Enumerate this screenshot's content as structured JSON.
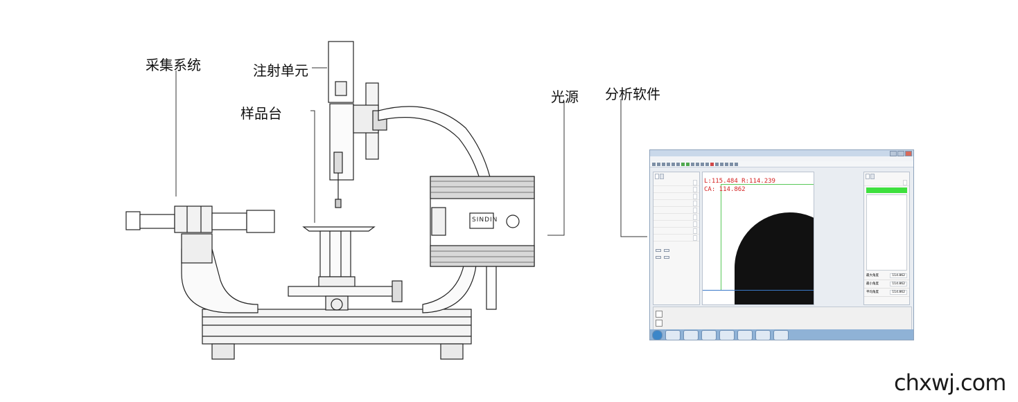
{
  "labels": {
    "acquisition": "采集系统",
    "injection": "注射单元",
    "stage": "样品台",
    "light": "光源",
    "software": "分析软件"
  },
  "watermark": "chxwj.com",
  "brand_plate": "SINDIN",
  "software": {
    "readout_lr": "L:115.484  R:114.239",
    "readout_ca": "CA: 114.862",
    "stats": [
      {
        "label": "最大角度",
        "value": "114.862"
      },
      {
        "label": "最小角度",
        "value": "114.862"
      },
      {
        "label": "平均角度",
        "value": "114.862"
      }
    ]
  },
  "colors": {
    "line": "#222222",
    "readout": "#d42020",
    "highlight": "#3ee03e"
  }
}
